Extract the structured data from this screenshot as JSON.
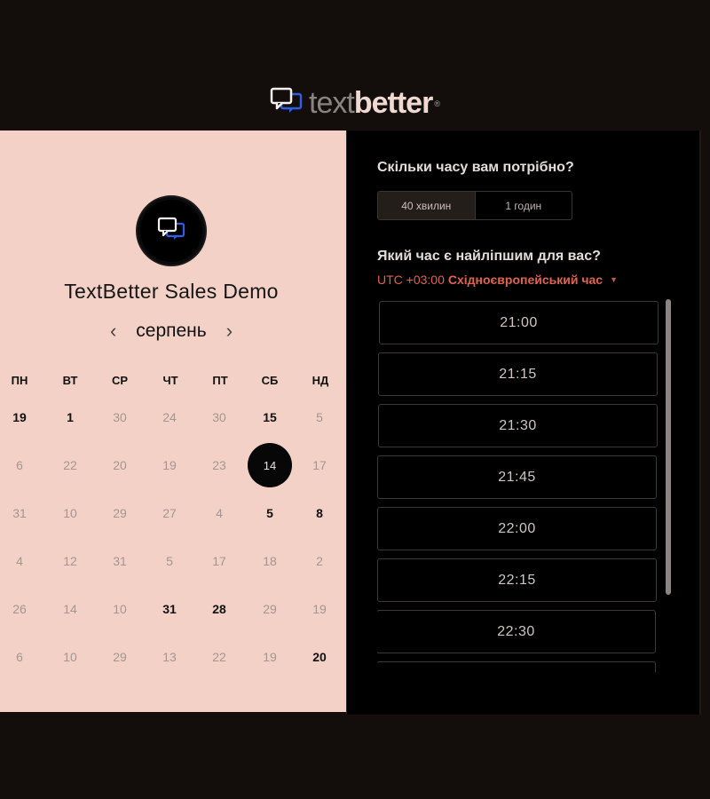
{
  "logo": {
    "part1": "text",
    "part2": "better",
    "reg": "®"
  },
  "event": {
    "title": "TextBetter Sales Demo"
  },
  "calendar": {
    "month": "серпень",
    "prev_icon": "‹",
    "next_icon": "›",
    "weekdays": [
      "ПН",
      "ВТ",
      "СР",
      "ЧТ",
      "ПТ",
      "СБ",
      "НД"
    ],
    "weeks": [
      [
        {
          "d": "19",
          "a": true
        },
        {
          "d": "1",
          "a": true
        },
        {
          "d": "30",
          "a": false
        },
        {
          "d": "24",
          "a": false
        },
        {
          "d": "30",
          "a": false
        },
        {
          "d": "15",
          "a": true
        },
        {
          "d": "5",
          "a": false
        }
      ],
      [
        {
          "d": "6",
          "a": false
        },
        {
          "d": "22",
          "a": false
        },
        {
          "d": "20",
          "a": false
        },
        {
          "d": "19",
          "a": false
        },
        {
          "d": "23",
          "a": false
        },
        {
          "d": "14",
          "a": true,
          "s": true
        },
        {
          "d": "17",
          "a": false
        }
      ],
      [
        {
          "d": "31",
          "a": false
        },
        {
          "d": "10",
          "a": false
        },
        {
          "d": "29",
          "a": false
        },
        {
          "d": "27",
          "a": false
        },
        {
          "d": "4",
          "a": false
        },
        {
          "d": "5",
          "a": true
        },
        {
          "d": "8",
          "a": true
        }
      ],
      [
        {
          "d": "4",
          "a": false
        },
        {
          "d": "12",
          "a": false
        },
        {
          "d": "31",
          "a": false
        },
        {
          "d": "5",
          "a": false
        },
        {
          "d": "17",
          "a": false
        },
        {
          "d": "18",
          "a": false
        },
        {
          "d": "2",
          "a": false
        }
      ],
      [
        {
          "d": "26",
          "a": false
        },
        {
          "d": "14",
          "a": false
        },
        {
          "d": "10",
          "a": false
        },
        {
          "d": "31",
          "a": true
        },
        {
          "d": "28",
          "a": true
        },
        {
          "d": "29",
          "a": false
        },
        {
          "d": "19",
          "a": false
        }
      ],
      [
        {
          "d": "6",
          "a": false
        },
        {
          "d": "10",
          "a": false
        },
        {
          "d": "29",
          "a": false
        },
        {
          "d": "13",
          "a": false
        },
        {
          "d": "22",
          "a": false
        },
        {
          "d": "19",
          "a": false
        },
        {
          "d": "20",
          "a": true
        }
      ]
    ]
  },
  "booking": {
    "duration_question": "Скільки часу вам потрібно?",
    "durations": [
      {
        "label": "40 хвилин",
        "active": true
      },
      {
        "label": "1 годин",
        "active": false
      }
    ],
    "time_question": "Який час є найліпшим для вас?",
    "timezone_offset": "UTC +03:00",
    "timezone_name": "Східноєвропейський час",
    "timezone_caret": "▼",
    "slots": [
      "21:00",
      "21:15",
      "21:30",
      "21:45",
      "22:00",
      "22:15",
      "22:30",
      ""
    ]
  },
  "colors": {
    "page_bg": "#130e0c",
    "left_bg": "#f3d1c6",
    "right_bg": "#000000",
    "accent_blue": "#2f5fe0",
    "timezone": "#e0624f"
  }
}
